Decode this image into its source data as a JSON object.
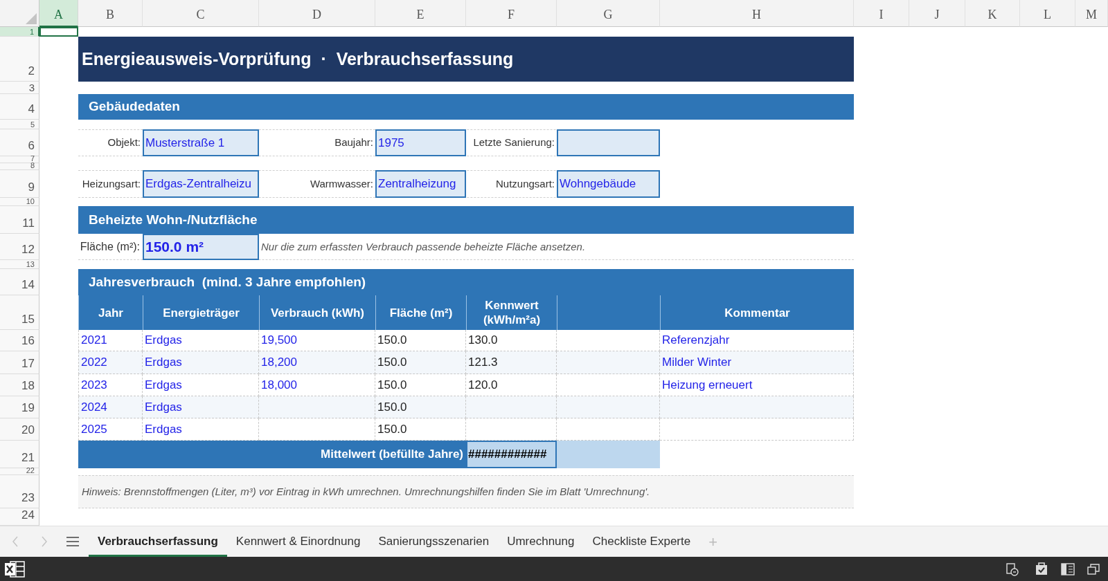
{
  "column_headers": [
    {
      "label": "A",
      "selected": true
    },
    {
      "label": "B",
      "selected": false
    },
    {
      "label": "C",
      "selected": false
    },
    {
      "label": "D",
      "selected": false
    },
    {
      "label": "E",
      "selected": false
    },
    {
      "label": "F",
      "selected": false
    },
    {
      "label": "G",
      "selected": false
    },
    {
      "label": "H",
      "selected": false
    },
    {
      "label": "I",
      "selected": false
    },
    {
      "label": "J",
      "selected": false
    },
    {
      "label": "K",
      "selected": false
    },
    {
      "label": "L",
      "selected": false
    },
    {
      "label": "M",
      "selected": false
    }
  ],
  "row_headers": [
    {
      "label": "1",
      "selected": true
    },
    {
      "label": "2",
      "selected": false
    },
    {
      "label": "3",
      "selected": false
    },
    {
      "label": "4",
      "selected": false
    },
    {
      "label": "5",
      "selected": false
    },
    {
      "label": "6",
      "selected": false
    },
    {
      "label": "7",
      "selected": false
    },
    {
      "label": "8",
      "selected": false
    },
    {
      "label": "9",
      "selected": false
    },
    {
      "label": "10",
      "selected": false
    },
    {
      "label": "11",
      "selected": false
    },
    {
      "label": "12",
      "selected": false
    },
    {
      "label": "13",
      "selected": false
    },
    {
      "label": "14",
      "selected": false
    },
    {
      "label": "15",
      "selected": false
    },
    {
      "label": "16",
      "selected": false
    },
    {
      "label": "17",
      "selected": false
    },
    {
      "label": "18",
      "selected": false
    },
    {
      "label": "19",
      "selected": false
    },
    {
      "label": "20",
      "selected": false
    },
    {
      "label": "21",
      "selected": false
    },
    {
      "label": "22",
      "selected": false
    },
    {
      "label": "23",
      "selected": false
    },
    {
      "label": "24",
      "selected": false
    }
  ],
  "title": "Energieausweis-Vorprüfung  ·  Verbrauchserfassung",
  "building": {
    "heading": "Gebäudedaten",
    "fields": [
      {
        "label": "Objekt:",
        "value": "Musterstraße 1"
      },
      {
        "label": "Baujahr:",
        "value": "1975"
      },
      {
        "label": "Letzte Sanierung:"
      },
      {
        "label": "Heizungsart:",
        "value": "Erdgas-Zentralheizu"
      },
      {
        "label": "Warmwasser:",
        "value": "Zentralheizung"
      },
      {
        "label": "Nutzungsart:",
        "value": "Wohngebäude"
      }
    ]
  },
  "area": {
    "heading": "Beheizte Wohn-/Nutzfläche",
    "label": "Fläche (m²):",
    "value": "150.0 m²",
    "note": "Nur die zum erfassten Verbrauch passende beheizte Fläche ansetzen."
  },
  "consumption": {
    "heading": "Jahresverbrauch  (mind. 3 Jahre empfohlen)",
    "columns": [
      "Jahr",
      "Energieträger",
      "Verbrauch (kWh)",
      "Fläche (m²)",
      "Kennwert (kWh/m²a)",
      "Kommentar"
    ],
    "rows": [
      {
        "year": "2021",
        "carrier": "Erdgas",
        "consumption": "19,500",
        "area": "150.0",
        "kennwert": "130.0",
        "comment": "Referenzjahr"
      },
      {
        "year": "2022",
        "carrier": "Erdgas",
        "consumption": "18,200",
        "area": "150.0",
        "kennwert": "121.3",
        "comment": "Milder Winter"
      },
      {
        "year": "2023",
        "carrier": "Erdgas",
        "consumption": "18,000",
        "area": "150.0",
        "kennwert": "120.0",
        "comment": "Heizung erneuert"
      },
      {
        "year": "2024",
        "carrier": "Erdgas",
        "area": "150.0"
      },
      {
        "year": "2025",
        "carrier": "Erdgas",
        "area": "150.0"
      }
    ],
    "summary": {
      "label": "Mittelwert (befüllte Jahre)",
      "value": "############"
    }
  },
  "hint": "Hinweis: Brennstoffmengen (Liter, m³) vor Eintrag in kWh umrechnen. Umrechnungshilfen finden Sie im Blatt 'Umrechnung'.",
  "sheet_tabs": [
    {
      "label": "Verbrauchserfassung",
      "selected": true
    },
    {
      "label": "Kennwert & Einordnung",
      "selected": false
    },
    {
      "label": "Sanierungsszenarien",
      "selected": false
    },
    {
      "label": "Umrechnung",
      "selected": false
    },
    {
      "label": "Checkliste Experte",
      "selected": false
    }
  ],
  "add_sheet": "+"
}
